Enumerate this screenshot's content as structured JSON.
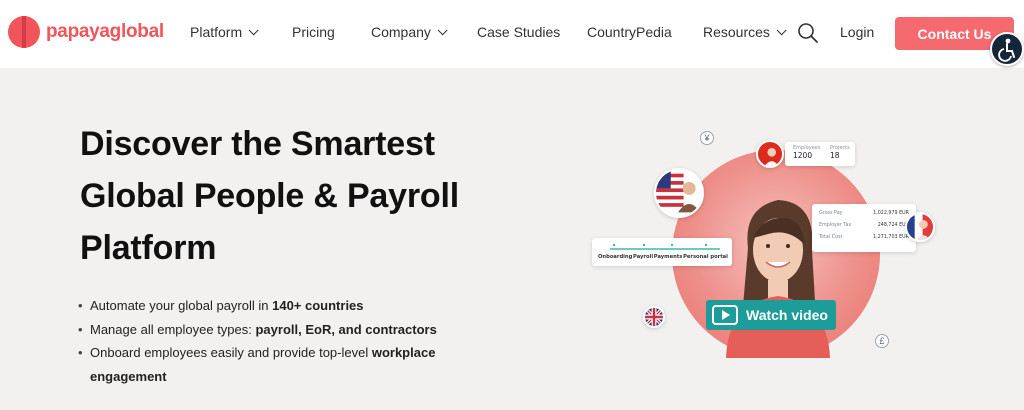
{
  "brand": {
    "name": "papayaglobal",
    "color": "#f2545b"
  },
  "nav": {
    "items": [
      {
        "label": "Platform",
        "has_dropdown": true
      },
      {
        "label": "Pricing",
        "has_dropdown": false
      },
      {
        "label": "Company",
        "has_dropdown": true
      },
      {
        "label": "Case Studies",
        "has_dropdown": false
      },
      {
        "label": "CountryPedia",
        "has_dropdown": false
      },
      {
        "label": "Resources",
        "has_dropdown": true
      }
    ],
    "search_icon": "search-icon",
    "login_label": "Login",
    "cta_label": "Contact Us",
    "cta_color": "#f46a6e",
    "accessibility_icon": "accessibility-icon"
  },
  "hero": {
    "title": "Discover the Smartest Global People & Payroll Platform",
    "bullets": [
      {
        "text": "Automate your global payroll in ",
        "bold": "140+ countries",
        "tail": ""
      },
      {
        "text": "Manage all employee types: ",
        "bold": "payroll, EoR, and contractors",
        "tail": ""
      },
      {
        "text": "Onboard employees easily and provide top-level ",
        "bold": "workplace engagement",
        "tail": ""
      }
    ]
  },
  "illustration": {
    "stats_card": {
      "employees_label": "Employees",
      "employees_value": "1200",
      "projects_label": "Projects",
      "projects_value": "18"
    },
    "payroll_card": [
      {
        "label": "Gross Pay",
        "value": "1,022,979 EUR"
      },
      {
        "label": "Employer Tax",
        "value": "248,724 EUR"
      },
      {
        "label": "Total Cost",
        "value": "1,271,703 EUR"
      }
    ],
    "steps": [
      "Onboarding",
      "Payroll",
      "Payments",
      "Personal portal"
    ],
    "watch_video_label": "Watch video",
    "currency_symbols": {
      "yen": "¥",
      "pound": "£"
    },
    "accent_teal": "#1e9c99"
  }
}
